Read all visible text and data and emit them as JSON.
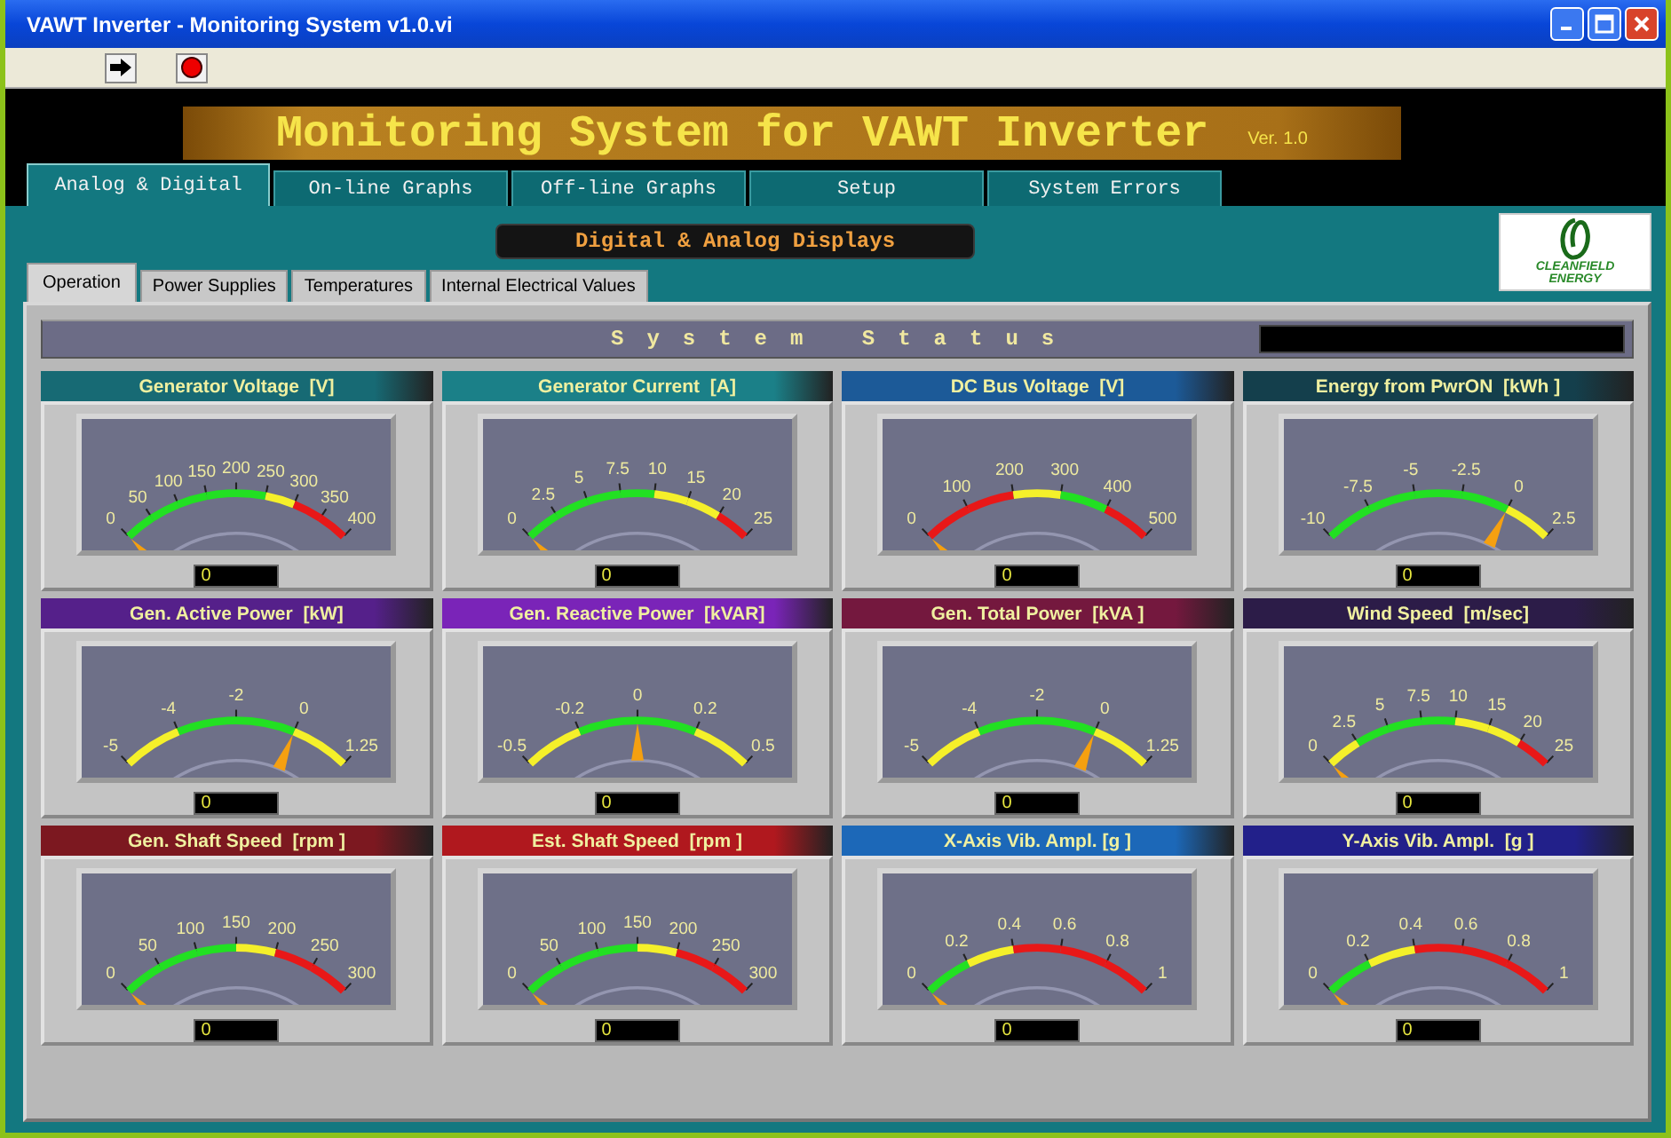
{
  "window": {
    "title": "VAWT Inverter - Monitoring System v1.0.vi"
  },
  "banner": {
    "title": "Monitoring System for VAWT Inverter",
    "version": "Ver. 1.0"
  },
  "tabs": [
    {
      "label": "Analog & Digital",
      "selected": true
    },
    {
      "label": "On-line Graphs",
      "selected": false
    },
    {
      "label": "Off-line Graphs",
      "selected": false
    },
    {
      "label": "Setup",
      "selected": false
    },
    {
      "label": "System Errors",
      "selected": false
    }
  ],
  "section_label": "Digital & Analog Displays",
  "logo": {
    "lines": [
      "CLEANFIELD",
      "ENERGY"
    ]
  },
  "subtabs": [
    {
      "label": "Operation",
      "selected": true
    },
    {
      "label": "Power Supplies",
      "selected": false
    },
    {
      "label": "Temperatures",
      "selected": false
    },
    {
      "label": "Internal Electrical Values",
      "selected": false
    }
  ],
  "status": {
    "label": "System Status"
  },
  "gauges": [
    {
      "title": "Generator Voltage  [V]",
      "color": "#176a74",
      "reading": "0",
      "ticks": [
        {
          "label": "0",
          "color": "#22e022"
        },
        {
          "label": "50",
          "color": "#22e022"
        },
        {
          "label": "100",
          "color": "#22e022"
        },
        {
          "label": "150",
          "color": "#22e022"
        },
        {
          "label": "200",
          "color": "#22e022"
        },
        {
          "label": "250",
          "color": "#f5f02a"
        },
        {
          "label": "300",
          "color": "#e81818"
        },
        {
          "label": "350",
          "color": "#e81818"
        },
        {
          "label": "400"
        }
      ]
    },
    {
      "title": "Generator Current  [A]",
      "color": "#1b8088",
      "reading": "0",
      "ticks": [
        {
          "label": "0",
          "color": "#22e022"
        },
        {
          "label": "2.5",
          "color": "#22e022"
        },
        {
          "label": "5",
          "color": "#22e022"
        },
        {
          "label": "7.5",
          "color": "#22e022"
        },
        {
          "label": "10",
          "color": "#f5f02a"
        },
        {
          "label": "15",
          "color": "#f5f02a"
        },
        {
          "label": "20",
          "color": "#e81818"
        },
        {
          "label": "25"
        }
      ]
    },
    {
      "title": "DC Bus Voltage  [V]",
      "color": "#1c5a98",
      "reading": "0",
      "ticks": [
        {
          "label": "0",
          "color": "#e81818"
        },
        {
          "label": "100",
          "color": "#e81818"
        },
        {
          "label": "200",
          "color": "#f5f02a"
        },
        {
          "label": "300",
          "color": "#22e022"
        },
        {
          "label": "400",
          "color": "#e81818"
        },
        {
          "label": "500"
        }
      ]
    },
    {
      "title": "Energy from PwrON  [kWh ]",
      "color": "#143f4c",
      "reading": "0",
      "ticks": [
        {
          "label": "-10",
          "color": "#22e022"
        },
        {
          "label": "-7.5",
          "color": "#22e022"
        },
        {
          "label": "-5",
          "color": "#22e022"
        },
        {
          "label": "-2.5",
          "color": "#22e022"
        },
        {
          "label": "0",
          "color": "#f5f02a"
        },
        {
          "label": "2.5"
        }
      ]
    },
    {
      "title": "Gen. Active Power  [kW]",
      "color": "#55208a",
      "reading": "0",
      "ticks": [
        {
          "label": "-5",
          "color": "#f5f02a"
        },
        {
          "label": "-4",
          "color": "#22e022"
        },
        {
          "label": "-2",
          "color": "#22e022"
        },
        {
          "label": "0",
          "color": "#f5f02a"
        },
        {
          "label": "1.25"
        }
      ]
    },
    {
      "title": "Gen. Reactive Power  [kVAR]",
      "color": "#7a24b8",
      "reading": "0",
      "ticks": [
        {
          "label": "-0.5",
          "color": "#f5f02a"
        },
        {
          "label": "-0.2",
          "color": "#22e022"
        },
        {
          "label": "0",
          "color": "#22e022"
        },
        {
          "label": "0.2",
          "color": "#f5f02a"
        },
        {
          "label": "0.5"
        }
      ]
    },
    {
      "title": "Gen. Total Power  [kVA ]",
      "color": "#74183e",
      "reading": "0",
      "ticks": [
        {
          "label": "-5",
          "color": "#f5f02a"
        },
        {
          "label": "-4",
          "color": "#22e022"
        },
        {
          "label": "-2",
          "color": "#22e022"
        },
        {
          "label": "0",
          "color": "#f5f02a"
        },
        {
          "label": "1.25"
        }
      ]
    },
    {
      "title": "Wind Speed  [m/sec]",
      "color": "#2c1c48",
      "reading": "0",
      "ticks": [
        {
          "label": "0",
          "color": "#f5f02a"
        },
        {
          "label": "2.5",
          "color": "#22e022"
        },
        {
          "label": "5",
          "color": "#22e022"
        },
        {
          "label": "7.5",
          "color": "#22e022"
        },
        {
          "label": "10",
          "color": "#f5f02a"
        },
        {
          "label": "15",
          "color": "#f5f02a"
        },
        {
          "label": "20",
          "color": "#e81818"
        },
        {
          "label": "25"
        }
      ]
    },
    {
      "title": "Gen. Shaft Speed  [rpm ]",
      "color": "#7c1820",
      "reading": "0",
      "ticks": [
        {
          "label": "0",
          "color": "#22e022"
        },
        {
          "label": "50",
          "color": "#22e022"
        },
        {
          "label": "100",
          "color": "#22e022"
        },
        {
          "label": "150",
          "color": "#f5f02a"
        },
        {
          "label": "200",
          "color": "#e81818"
        },
        {
          "label": "250",
          "color": "#e81818"
        },
        {
          "label": "300"
        }
      ]
    },
    {
      "title": "Est. Shaft Speed  [rpm ]",
      "color": "#b0181e",
      "reading": "0",
      "ticks": [
        {
          "label": "0",
          "color": "#22e022"
        },
        {
          "label": "50",
          "color": "#22e022"
        },
        {
          "label": "100",
          "color": "#22e022"
        },
        {
          "label": "150",
          "color": "#f5f02a"
        },
        {
          "label": "200",
          "color": "#e81818"
        },
        {
          "label": "250",
          "color": "#e81818"
        },
        {
          "label": "300"
        }
      ]
    },
    {
      "title": "X-Axis Vib. Ampl. [g ]",
      "color": "#1c68b8",
      "reading": "0",
      "ticks": [
        {
          "label": "0",
          "color": "#22e022"
        },
        {
          "label": "0.2",
          "color": "#f5f02a"
        },
        {
          "label": "0.4",
          "color": "#e81818"
        },
        {
          "label": "0.6",
          "color": "#e81818"
        },
        {
          "label": "0.8",
          "color": "#e81818"
        },
        {
          "label": "1"
        }
      ]
    },
    {
      "title": "Y-Axis Vib. Ampl.  [g ]",
      "color": "#22208a",
      "reading": "0",
      "ticks": [
        {
          "label": "0",
          "color": "#22e022"
        },
        {
          "label": "0.2",
          "color": "#f5f02a"
        },
        {
          "label": "0.4",
          "color": "#e81818"
        },
        {
          "label": "0.6",
          "color": "#e81818"
        },
        {
          "label": "0.8",
          "color": "#e81818"
        },
        {
          "label": "1"
        }
      ]
    }
  ]
}
